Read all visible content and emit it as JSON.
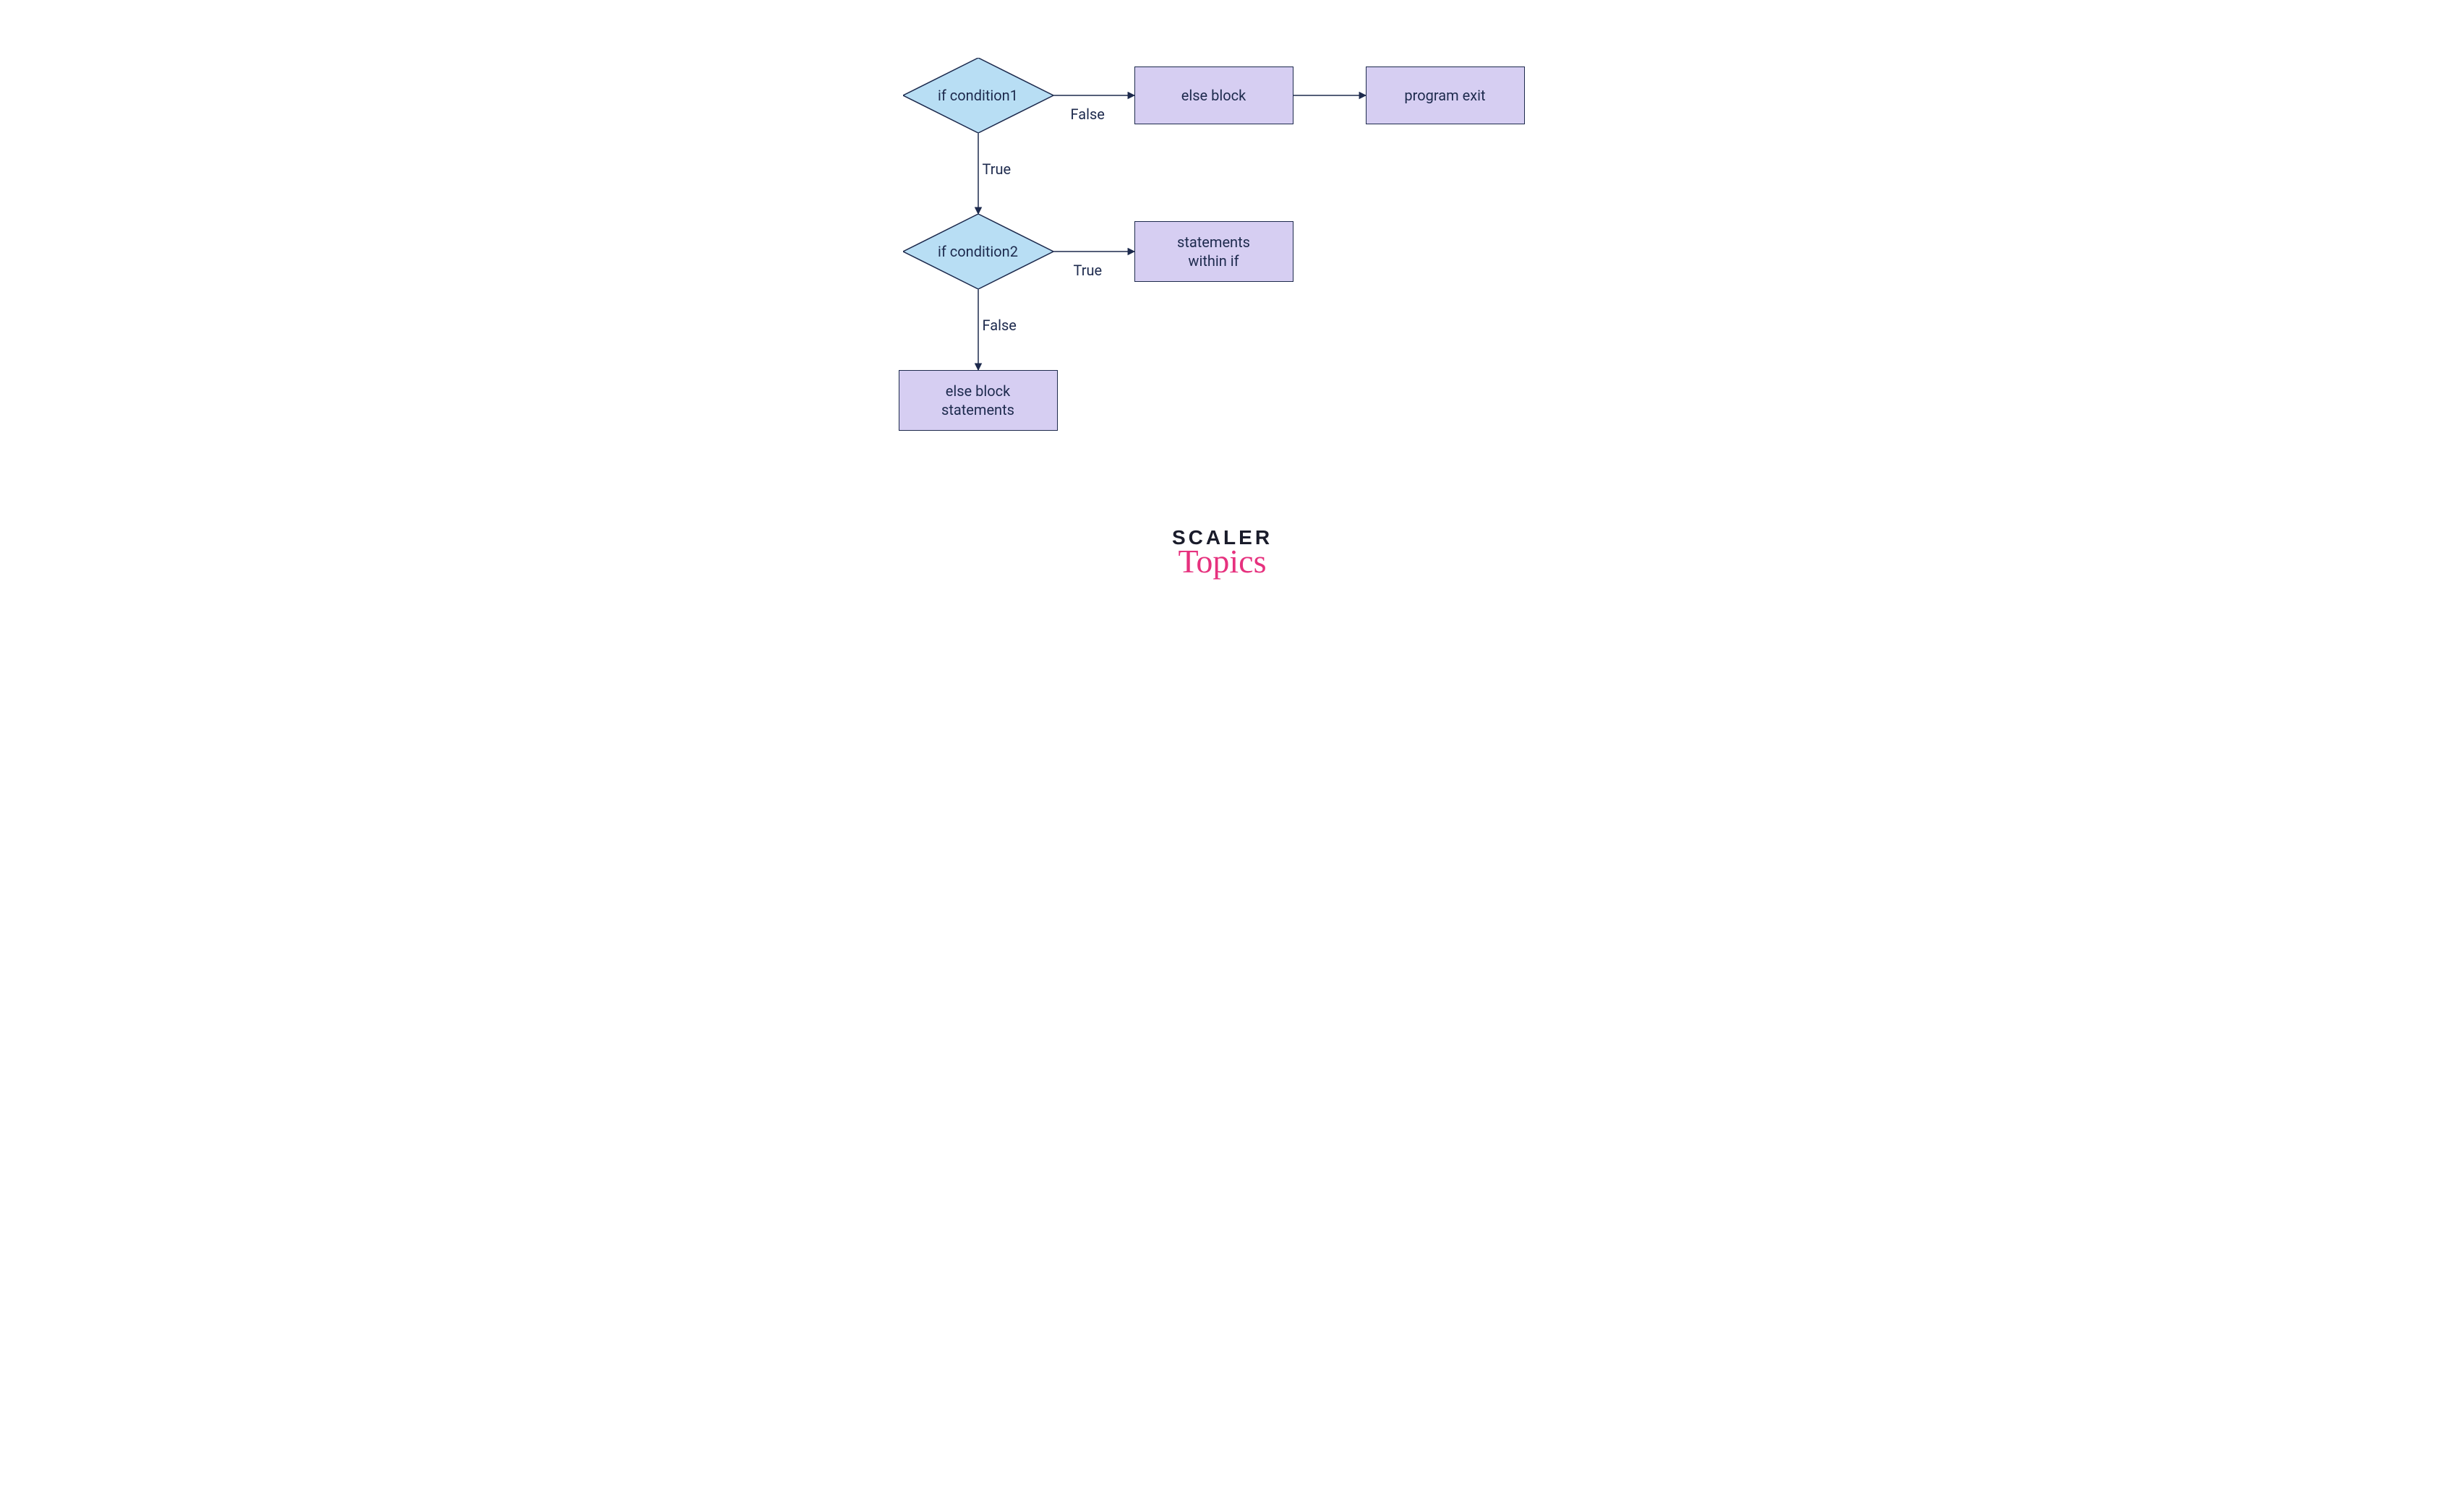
{
  "colors": {
    "diamond_fill": "#b8def4",
    "rect_fill": "#d6cef2",
    "stroke": "#1d2a4d",
    "text": "#1d2a4d",
    "logo_dark": "#1a1c2b",
    "logo_pink": "#e6317e"
  },
  "nodes": {
    "cond1": {
      "type": "decision",
      "label": "if condition1"
    },
    "cond2": {
      "type": "decision",
      "label": "if condition2"
    },
    "else_block": {
      "type": "process",
      "label": "else block"
    },
    "program_exit": {
      "type": "process",
      "label": "program exit"
    },
    "stmts_within_if": {
      "type": "process",
      "label": "statements\nwithin if"
    },
    "else_block_stmts": {
      "type": "process",
      "label": "else block\nstatements"
    }
  },
  "edges": {
    "cond1_right": {
      "from": "cond1",
      "to": "else_block",
      "label": "False"
    },
    "elseblock_right": {
      "from": "else_block",
      "to": "program_exit",
      "label": ""
    },
    "cond1_down": {
      "from": "cond1",
      "to": "cond2",
      "label": "True"
    },
    "cond2_right": {
      "from": "cond2",
      "to": "stmts_within_if",
      "label": "True"
    },
    "cond2_down": {
      "from": "cond2",
      "to": "else_block_stmts",
      "label": "False"
    }
  },
  "logo": {
    "line1": "SCALER",
    "line2": "Topics"
  }
}
